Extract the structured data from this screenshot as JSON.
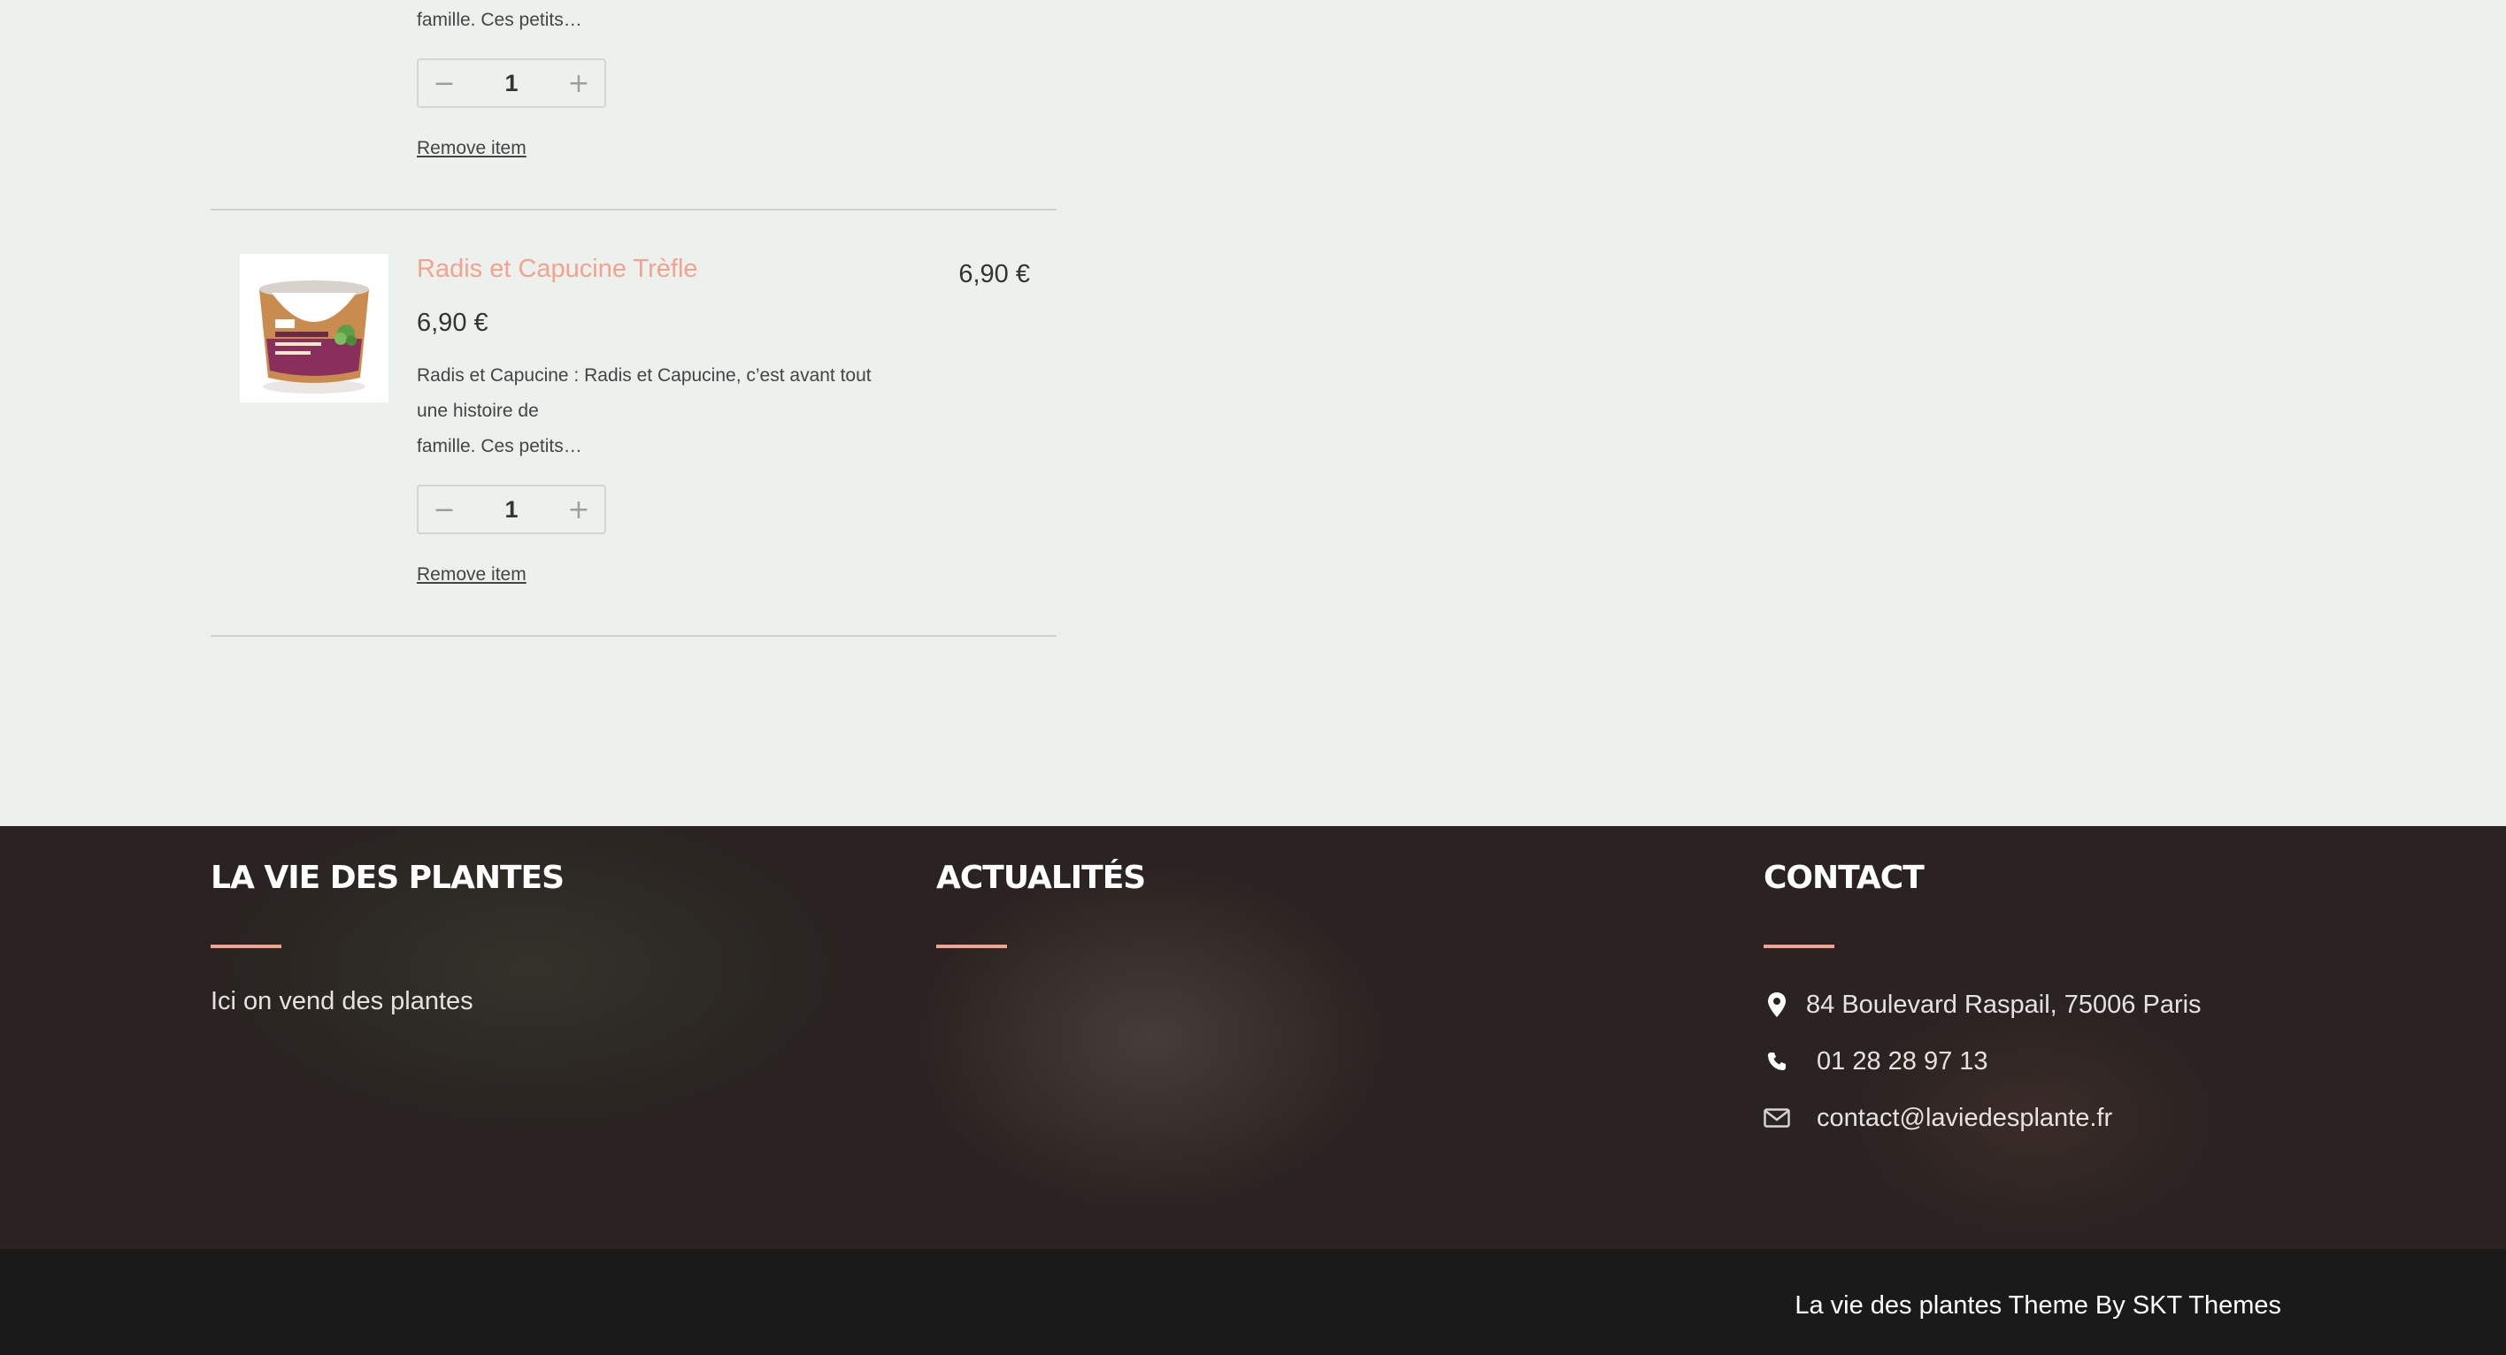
{
  "cart": {
    "item1": {
      "desc_tail": "famille. Ces petits…",
      "quantity": "1",
      "remove_label": "Remove item",
      "minus_glyph": "−",
      "plus_glyph": "+"
    },
    "item2": {
      "name": "Radis et Capucine Trèfle",
      "unit_price": "6,90 €",
      "line_total": "6,90 €",
      "desc_line1": "Radis et Capucine : Radis et Capucine, c’est avant tout",
      "desc_line2": "une histoire de",
      "desc_line3": "famille. Ces petits…",
      "quantity": "1",
      "remove_label": "Remove item",
      "minus_glyph": "−",
      "plus_glyph": "+",
      "image_icon": "product-pot-image"
    }
  },
  "footer": {
    "about": {
      "title": "LA VIE DES PLANTES",
      "text": "Ici on vend des plantes"
    },
    "news": {
      "title": "ACTUALITÉS"
    },
    "contact": {
      "title": "CONTACT",
      "address": "84 Boulevard Raspail, 75006 Paris",
      "phone": "01 28 28 97 13",
      "email": "contact@laviedesplante.fr",
      "icons": [
        "map-pin-icon",
        "phone-icon",
        "envelope-icon"
      ]
    },
    "copyright": "La vie des plantes Theme By SKT Themes"
  },
  "colors": {
    "background": "#edf1ed",
    "accent": "#f2a38f",
    "footer_bg": "#2a2321",
    "bottom_bar": "#1a1a1a"
  }
}
